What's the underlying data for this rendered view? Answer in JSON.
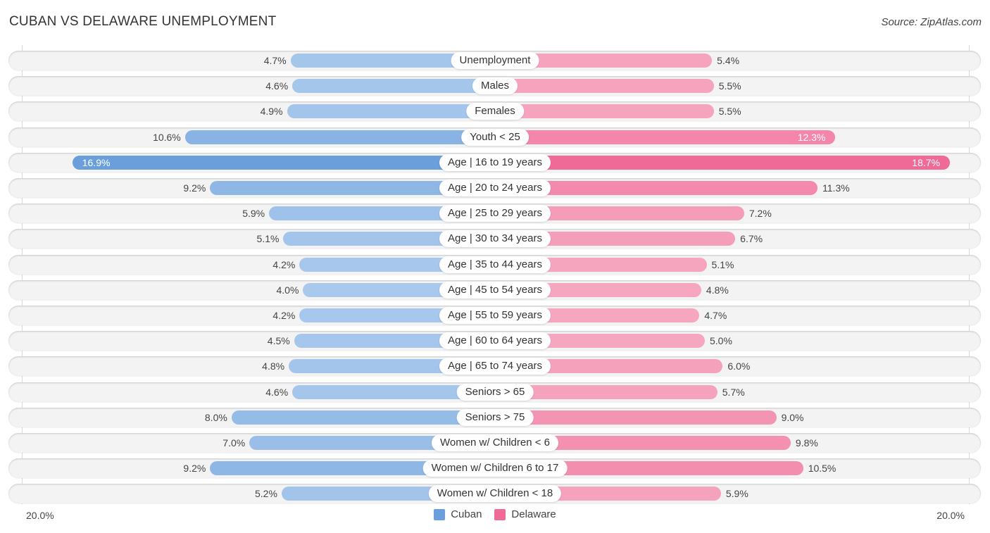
{
  "title": "CUBAN VS DELAWARE UNEMPLOYMENT",
  "source": "Source: ZipAtlas.com",
  "chart_data": {
    "type": "bar",
    "orientation": "horizontal-diverging",
    "title": "CUBAN VS DELAWARE UNEMPLOYMENT",
    "xlim": [
      -20,
      20
    ],
    "axis_ticks": [
      "20.0%",
      "20.0%"
    ],
    "legend_position": "bottom-center",
    "categories": [
      "Unemployment",
      "Males",
      "Females",
      "Youth < 25",
      "Age | 16 to 19 years",
      "Age | 20 to 24 years",
      "Age | 25 to 29 years",
      "Age | 30 to 34 years",
      "Age | 35 to 44 years",
      "Age | 45 to 54 years",
      "Age | 55 to 59 years",
      "Age | 60 to 64 years",
      "Age | 65 to 74 years",
      "Seniors > 65",
      "Seniors > 75",
      "Women w/ Children < 6",
      "Women w/ Children 6 to 17",
      "Women w/ Children < 18"
    ],
    "series": [
      {
        "name": "Cuban",
        "color": "#6a9fdc",
        "light_color": "#a8c8ec",
        "values": [
          4.7,
          4.6,
          4.9,
          10.6,
          16.9,
          9.2,
          5.9,
          5.1,
          4.2,
          4.0,
          4.2,
          4.5,
          4.8,
          4.6,
          8.0,
          7.0,
          9.2,
          5.2
        ]
      },
      {
        "name": "Delaware",
        "color": "#f06a98",
        "light_color": "#f6a8c0",
        "values": [
          5.4,
          5.5,
          5.5,
          12.3,
          18.7,
          11.3,
          7.2,
          6.7,
          5.1,
          4.8,
          4.7,
          5.0,
          6.0,
          5.7,
          9.0,
          9.8,
          10.5,
          5.9
        ]
      }
    ]
  },
  "legend": [
    {
      "label": "Cuban",
      "color": "#6a9fdc"
    },
    {
      "label": "Delaware",
      "color": "#f06a98"
    }
  ]
}
